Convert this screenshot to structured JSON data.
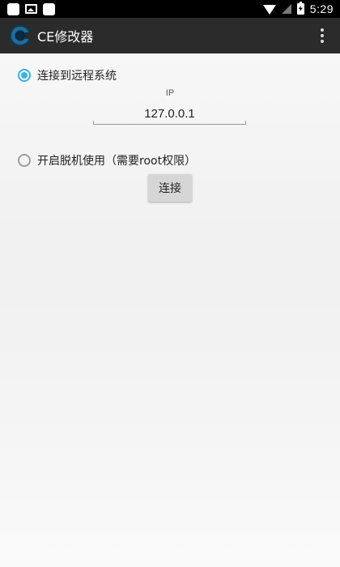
{
  "status_bar": {
    "time": "5:29",
    "icons": [
      "notification-square-icon",
      "gallery-icon",
      "notification-square-icon",
      "wifi-icon",
      "signal-icon",
      "battery-charging-icon"
    ]
  },
  "app_bar": {
    "title": "CE修改器",
    "logo_icon": "ce-logo-icon",
    "menu_icon": "overflow-menu-icon"
  },
  "connection": {
    "remote_option_label": "连接到远程系统",
    "remote_selected": true,
    "ip_label": "IP",
    "ip_value": "127.0.0.1",
    "offline_option_label": "开启脱机使用（需要root权限）",
    "offline_selected": false,
    "connect_label": "连接"
  },
  "colors": {
    "accent": "#33b5e5",
    "app_bar": "#2b2b2b",
    "status_bar": "#000000"
  }
}
